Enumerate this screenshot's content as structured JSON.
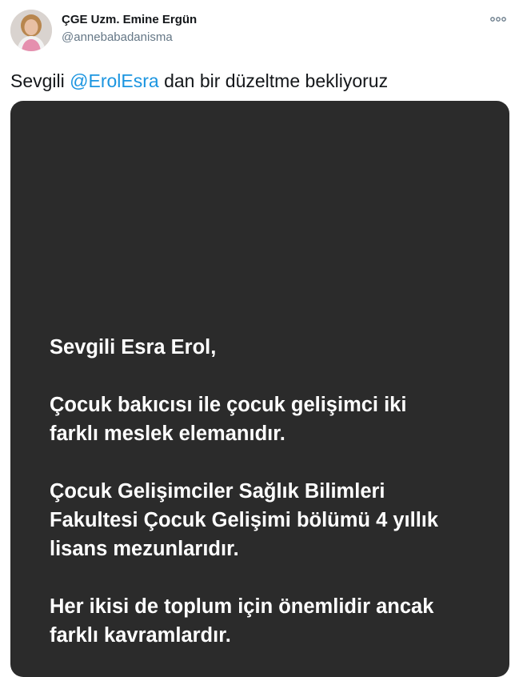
{
  "user": {
    "name": "ÇGE Uzm. Emine Ergün",
    "handle": "@annebabadanisma"
  },
  "tweet": {
    "text_before": "Sevgili ",
    "mention": "@ErolEsra",
    "text_after": " dan bir düzeltme bekliyoruz"
  },
  "media": {
    "lines": [
      "Sevgili Esra Erol,",
      "Çocuk bakıcısı ile çocuk gelişimci iki",
      "farklı meslek elemanıdır.",
      "Çocuk Gelişimciler Sağlık Bilimleri",
      "Fakultesi Çocuk Gelişimi bölümü 4 yıllık",
      "lisans mezunlarıdır.",
      "Her ikisi de toplum için önemlidir ancak",
      "farklı kavramlardır."
    ]
  },
  "icons": {
    "more": "more-options-icon",
    "avatar": "profile-photo"
  },
  "colors": {
    "mention": "#1b95e0",
    "handle": "#657786",
    "media_bg": "#2b2b2b"
  }
}
